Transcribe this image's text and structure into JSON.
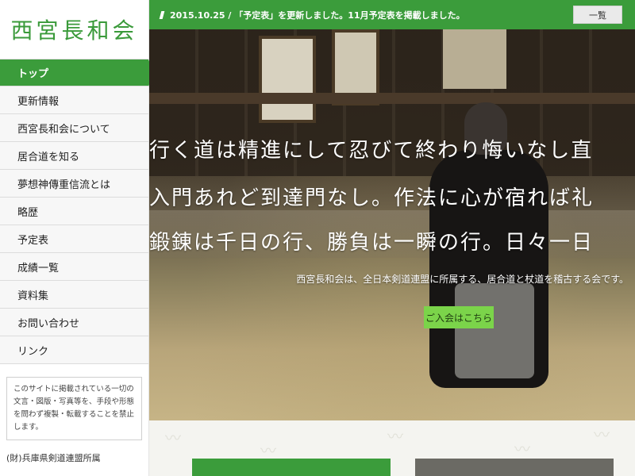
{
  "sidebar": {
    "logo": "西宮長和会",
    "nav": [
      {
        "label": "トップ",
        "active": true
      },
      {
        "label": "更新情報"
      },
      {
        "label": "西宮長和会について"
      },
      {
        "label": "居合道を知る"
      },
      {
        "label": "夢想神傳重信流とは"
      },
      {
        "label": "略歴"
      },
      {
        "label": "予定表"
      },
      {
        "label": "成績一覧"
      },
      {
        "label": "資料集"
      },
      {
        "label": "お問い合わせ"
      },
      {
        "label": "リンク"
      }
    ],
    "notice": "このサイトに掲載されている一切の文言・図版・写真等を、手段や形態を問わず複製・転載することを禁止します。",
    "affiliation": "(財)兵庫県剣道連盟所属"
  },
  "newsbar": {
    "text": "2015.10.25 / 「予定表」を更新しました。11月予定表を掲載しました。",
    "button": "一覧"
  },
  "hero": {
    "lines": [
      "行く道は精進にして忍びて終わり悔いなし直",
      "入門あれど到達門なし。作法に心が宿れば礼",
      "鍛錬は千日の行、勝負は一瞬の行。日々一日"
    ],
    "subtitle": "西宮長和会は、全日本剣道連盟に所属する、居合道と杖道を稽古する会です。",
    "join_button": "ご入会はこちら"
  },
  "colors": {
    "accent": "#3b9c3b",
    "logo": "#3a9a3a",
    "join_button": "#7bd44a"
  }
}
